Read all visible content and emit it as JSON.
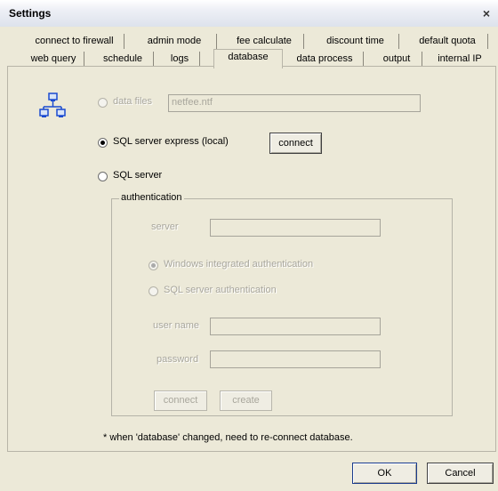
{
  "window": {
    "title": "Settings",
    "close_label": "×"
  },
  "tabs_row1": [
    "connect to firewall",
    "admin mode",
    "fee calculate",
    "discount time",
    "default quota"
  ],
  "tabs_row2": [
    "web query",
    "schedule",
    "logs",
    "database",
    "data process",
    "output",
    "internal IP"
  ],
  "selected_tab": "database",
  "database": {
    "data_files_label": "data files",
    "data_files_value": "netfee.ntf",
    "sql_express_label": "SQL server express (local)",
    "connect_label": "connect",
    "sql_server_label": "SQL server",
    "selected_option": "SQL server express (local)",
    "auth_group_label": "authentication",
    "server_label": "server",
    "server_value": "",
    "windows_auth_label": "Windows integrated authentication",
    "sql_auth_label": "SQL server authentication",
    "user_name_label": "user name",
    "password_label": "password",
    "auth_connect_label": "connect",
    "create_label": "create",
    "note": "* when 'database' changed, need to re-connect database."
  },
  "footer": {
    "ok_label": "OK",
    "cancel_label": "Cancel"
  },
  "icon": {
    "name": "network-computers-icon",
    "accent": "#1a4ad0"
  }
}
